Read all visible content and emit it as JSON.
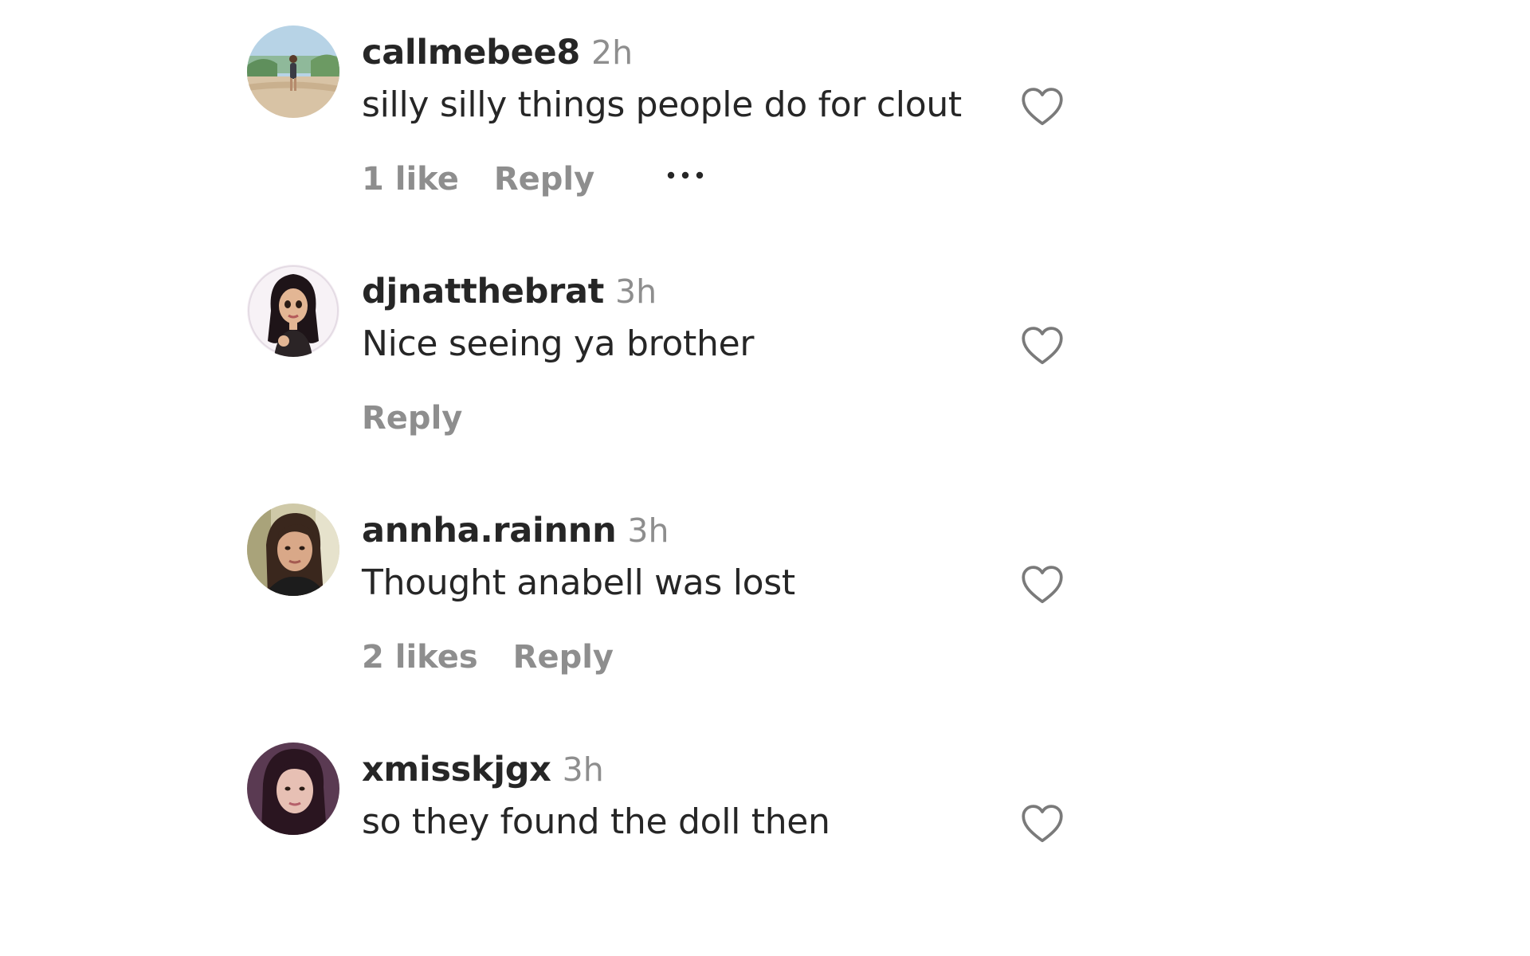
{
  "comments": [
    {
      "username": "callmebee8",
      "time": "2h",
      "text": "silly silly things people do for clout",
      "likes": "1 like",
      "reply": "Reply",
      "has_more": true,
      "avatar": "beach-photo-avatar"
    },
    {
      "username": "djnatthebrat",
      "time": "3h",
      "text": "Nice seeing ya brother",
      "likes": "",
      "reply": "Reply",
      "has_more": false,
      "avatar": "doll-avatar"
    },
    {
      "username": "annha.rainnn",
      "time": "3h",
      "text": "Thought anabell was lost",
      "likes": "2 likes",
      "reply": "Reply",
      "has_more": false,
      "avatar": "selfie-avatar"
    },
    {
      "username": "xmisskjgx",
      "time": "3h",
      "text": "so they found the doll then",
      "likes": "",
      "reply": "",
      "has_more": false,
      "avatar": "portrait-avatar"
    }
  ],
  "icons": {
    "like": "heart-outline-icon",
    "more": "more-options-icon"
  },
  "colors": {
    "primary_text": "#262626",
    "secondary_text": "#8e8e8e",
    "icon": "#7a7a7a",
    "background": "#ffffff"
  }
}
